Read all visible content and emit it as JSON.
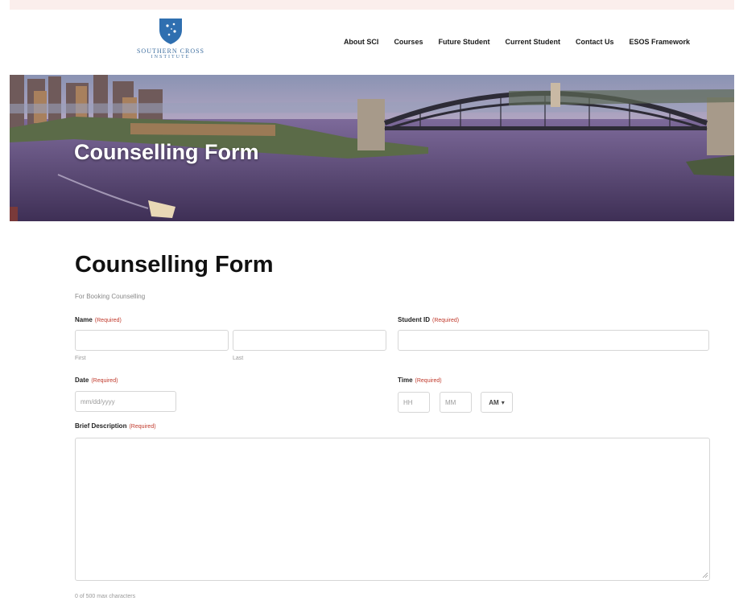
{
  "logo": {
    "name": "SOUTHERN CROSS",
    "sub": "INSTITUTE"
  },
  "nav": {
    "items": [
      "About SCI",
      "Courses",
      "Future Student",
      "Current Student",
      "Contact Us",
      "ESOS Framework"
    ]
  },
  "hero": {
    "title": "Counselling Form"
  },
  "form": {
    "title": "Counselling Form",
    "description": "For Booking Counselling",
    "required": "(Required)",
    "name": {
      "label": "Name",
      "first": "First",
      "last": "Last"
    },
    "student_id": {
      "label": "Student ID"
    },
    "date": {
      "label": "Date",
      "placeholder": "mm/dd/yyyy"
    },
    "time": {
      "label": "Time",
      "hh": "HH",
      "mm": "MM",
      "ampm": "AM"
    },
    "brief": {
      "label": "Brief Description"
    },
    "counter": "0 of 500 max characters"
  },
  "colors": {
    "brand_blue": "#2f6fb0",
    "required_red": "#c0392b"
  }
}
